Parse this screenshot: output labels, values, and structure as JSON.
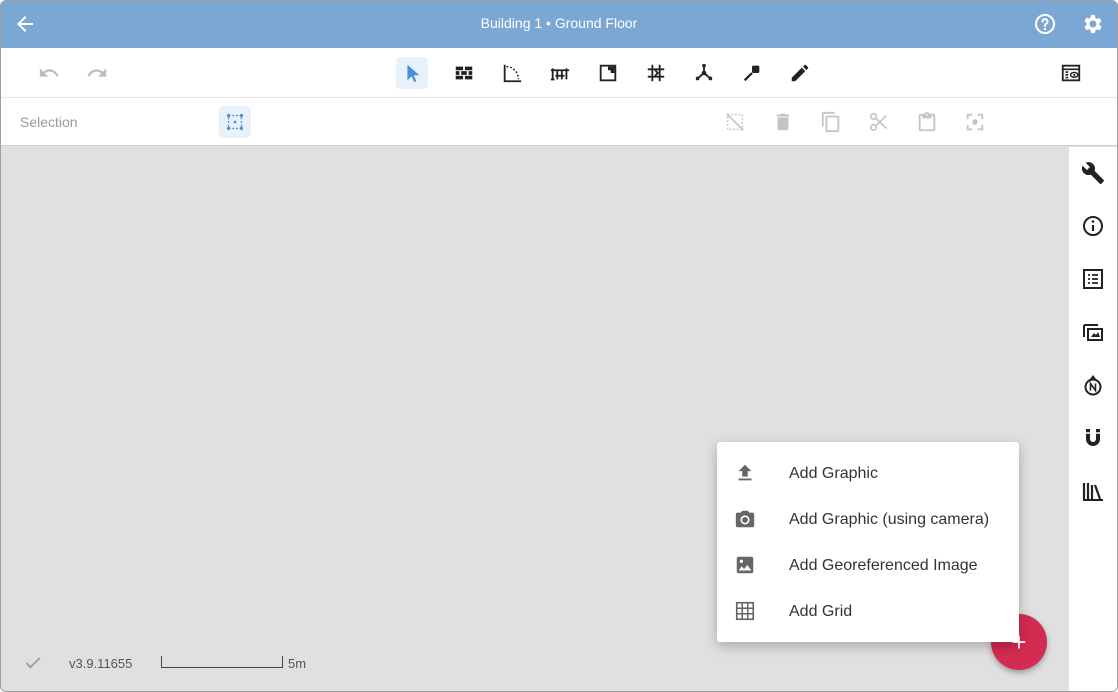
{
  "header": {
    "title": "Building 1 • Ground Floor",
    "back_icon": "arrow-left-icon",
    "help_icon": "help-circle-icon",
    "settings_icon": "gear-icon"
  },
  "toolbar": {
    "undo_icon": "undo-icon",
    "redo_icon": "redo-icon",
    "tools": [
      "select-pointer-icon",
      "wall-icon",
      "arc-icon",
      "railing-icon",
      "room-icon",
      "grid-snap-icon",
      "vertex-icon",
      "marker-icon",
      "pencil-icon"
    ],
    "view_icon": "layers-view-icon"
  },
  "selection_bar": {
    "label": "Selection",
    "actions": [
      "deselect-icon",
      "delete-icon",
      "copy-icon",
      "cut-icon",
      "paste-icon",
      "focus-icon"
    ]
  },
  "sidebar": {
    "items": [
      "wrench-icon",
      "info-icon",
      "list-icon",
      "overlay-icon",
      "compass-north-icon",
      "magnet-icon",
      "library-icon"
    ]
  },
  "status": {
    "version": "v3.9.11655",
    "scale_label": "5m"
  },
  "menu": {
    "items": [
      {
        "label": "Add Graphic",
        "icon": "upload-icon"
      },
      {
        "label": "Add Graphic (using camera)",
        "icon": "camera-icon"
      },
      {
        "label": "Add Georeferenced Image",
        "icon": "image-icon"
      },
      {
        "label": "Add Grid",
        "icon": "grid-icon"
      }
    ]
  },
  "fab": {
    "label": "+"
  },
  "colors": {
    "header": "#7ba7d4",
    "fab": "#d42b52",
    "active_tool": "#4a8fd8",
    "canvas": "#e0e0e0"
  }
}
